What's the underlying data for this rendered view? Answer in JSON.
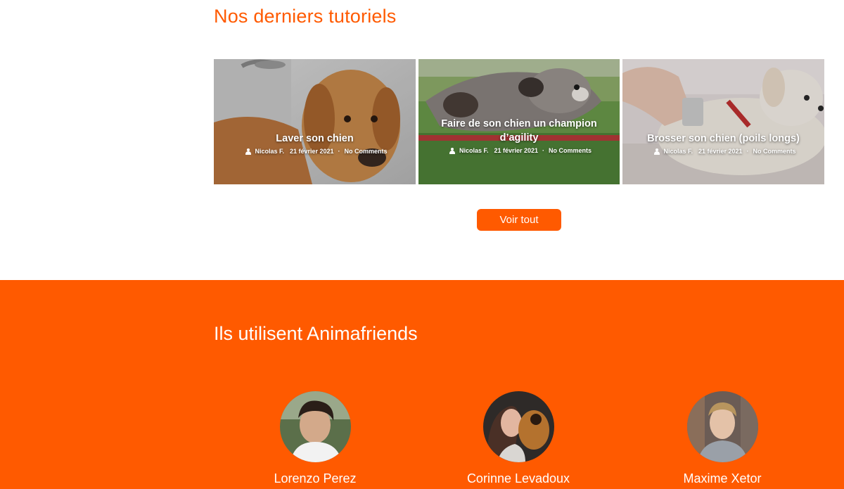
{
  "tutorials": {
    "heading": "Nos derniers tutoriels",
    "cards": [
      {
        "title": "Laver son chien",
        "author": "Nicolas F.",
        "date": "21 février 2021",
        "comments": "No Comments"
      },
      {
        "title": "Faire de son chien un champion d’agility",
        "author": "Nicolas F.",
        "date": "21 février 2021",
        "comments": "No Comments"
      },
      {
        "title": "Brosser son chien (poils longs)",
        "author": "Nicolas F.",
        "date": "21 février 2021",
        "comments": "No Comments"
      }
    ],
    "see_all_label": "Voir tout"
  },
  "testimonials": {
    "heading": "Ils utilisent Animafriends",
    "people": [
      {
        "name": "Lorenzo Perez"
      },
      {
        "name": "Corinne Levadoux"
      },
      {
        "name": "Maxime Xetor"
      }
    ]
  },
  "colors": {
    "accent": "#ff5a00",
    "background": "#ffffff",
    "text_on_accent": "#ffffff"
  }
}
